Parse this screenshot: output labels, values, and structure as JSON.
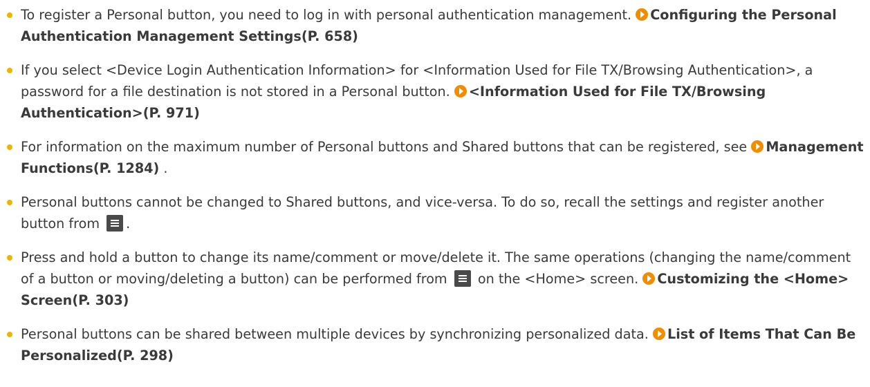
{
  "notes": [
    {
      "text1": "To register a Personal button, you need to log in with personal authentication management. ",
      "link": "Configuring the Personal Authentication Management Settings(P. 658)"
    },
    {
      "text1": "If you select <Device Login Authentication Information> for <Information Used for File TX/Browsing Authentication>, a password for a file destination is not stored in a Personal button. ",
      "link": "<Information Used for File TX/Browsing Authentication>(P. 971)"
    },
    {
      "text1": "For information on the maximum number of Personal buttons and Shared buttons that can be registered, see ",
      "link": "Management Functions(P. 1284)",
      "text2": " ."
    },
    {
      "text1": "Personal buttons cannot be changed to Shared buttons, and vice-versa. To do so, recall the settings and register another button from ",
      "text2": "."
    },
    {
      "text1": "Press and hold a button to change its name/comment or move/delete it. The same operations (changing the name/comment of a button or moving/deleting a button) can be performed from ",
      "text2": " on the <Home> screen. ",
      "link": "Customizing the <Home> Screen(P. 303)"
    },
    {
      "text1": "Personal buttons can be shared between multiple devices by synchronizing personalized data. ",
      "link": "List of Items That Can Be Personalized(P. 298)"
    }
  ],
  "icons": {
    "bullet_color": "#f0b400",
    "link_arrow_color": "#f28c00",
    "menu_icon": "menu-icon"
  }
}
